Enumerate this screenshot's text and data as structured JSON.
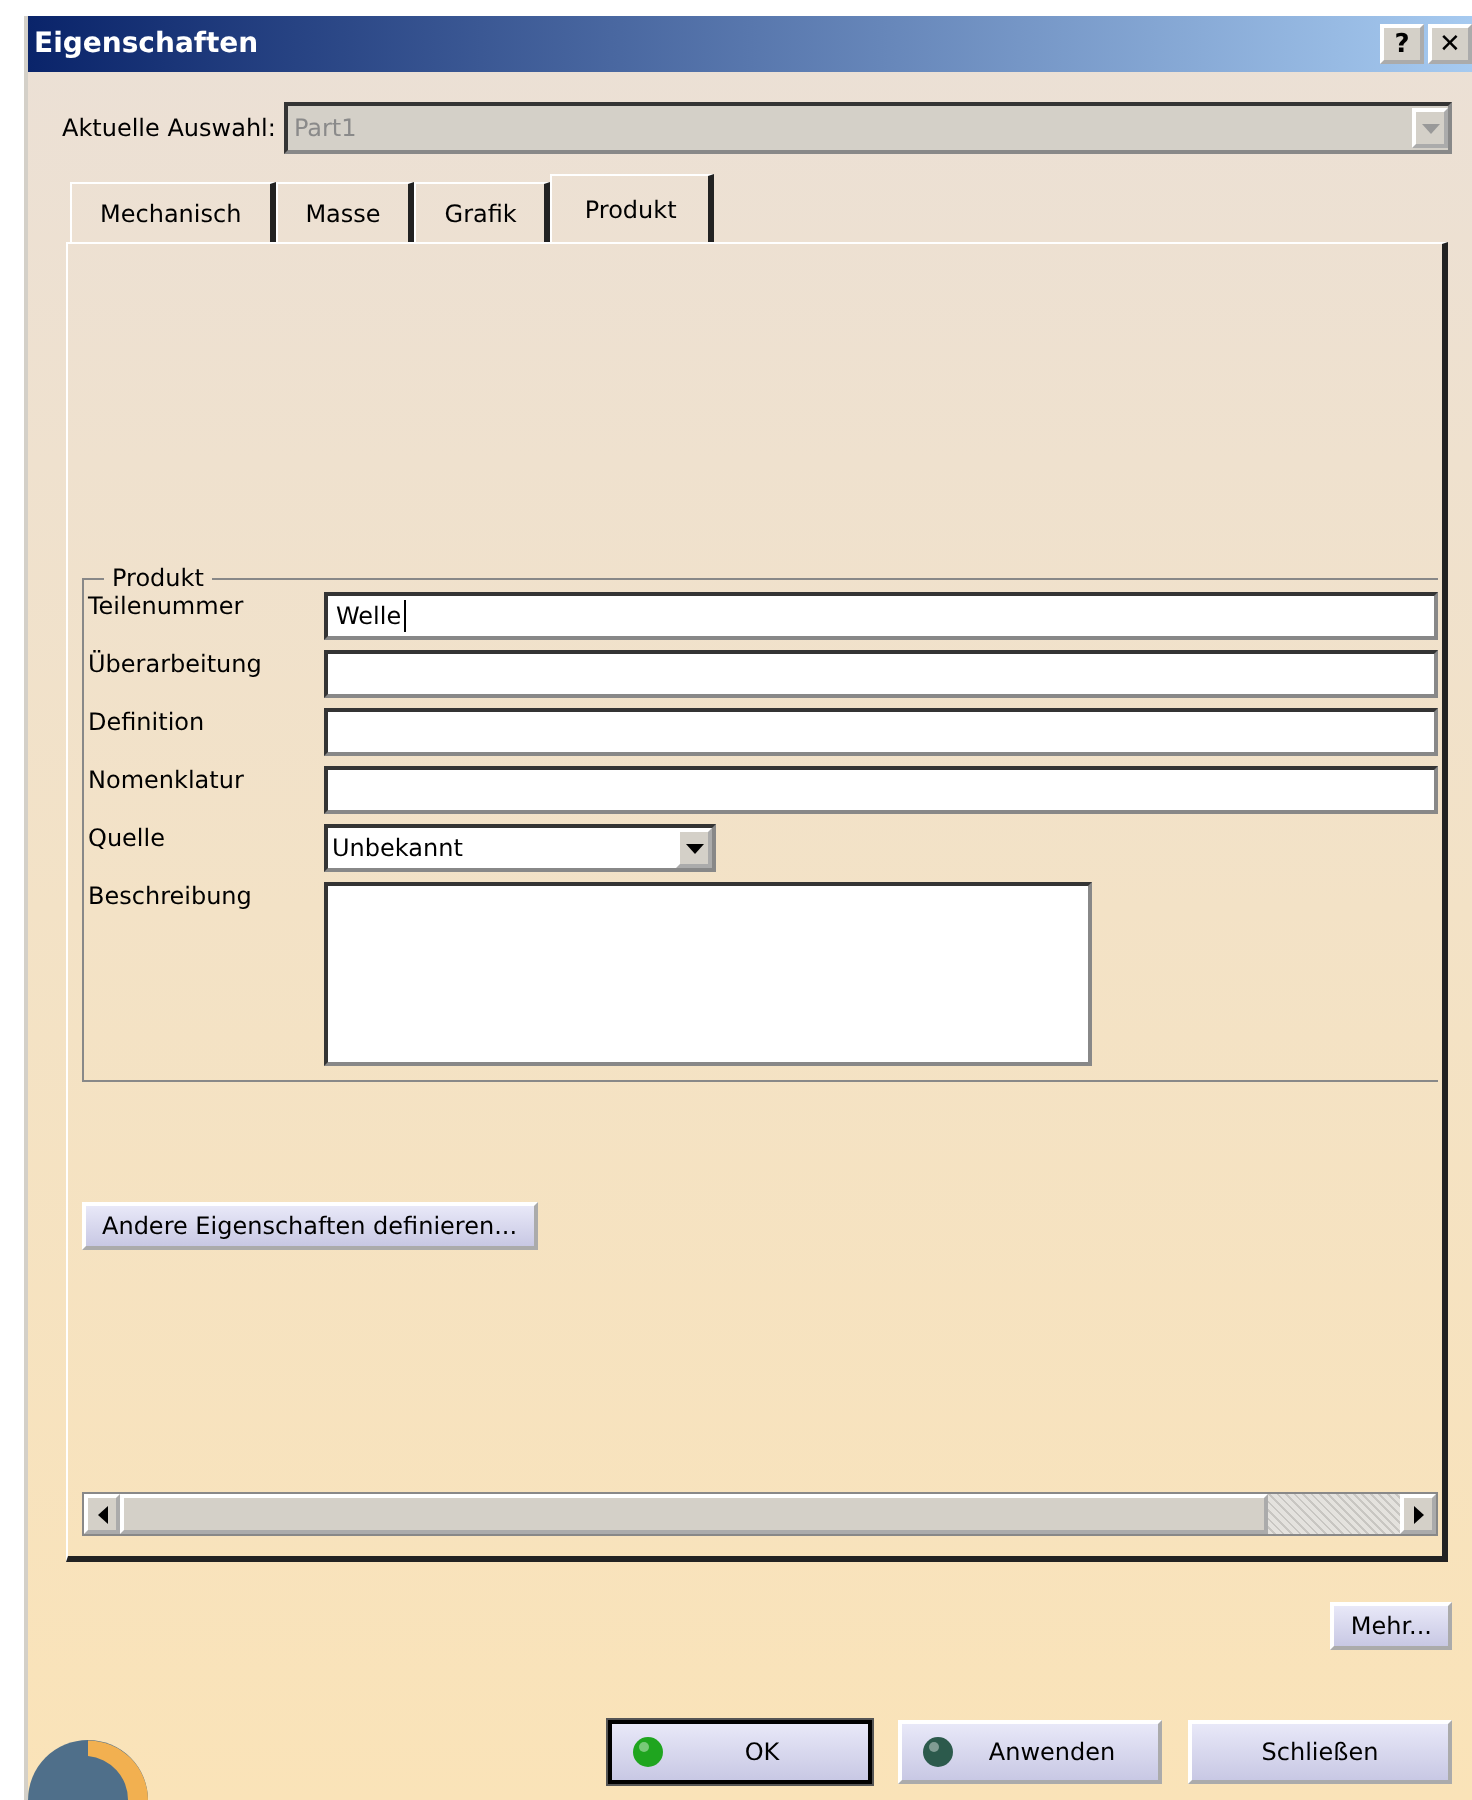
{
  "window": {
    "title": "Eigenschaften",
    "help": "?",
    "close": "✕"
  },
  "selection": {
    "label": "Aktuelle Auswahl:",
    "value": "Part1",
    "disabled": true
  },
  "tabs": [
    {
      "label": "Mechanisch",
      "selected": false
    },
    {
      "label": "Masse",
      "selected": false
    },
    {
      "label": "Grafik",
      "selected": false
    },
    {
      "label": "Produkt",
      "selected": true
    }
  ],
  "group": {
    "title": "Produkt",
    "fields": [
      {
        "kind": "text",
        "label": "Teilenummer",
        "value": "Welle",
        "focused": true
      },
      {
        "kind": "text",
        "label": "Überarbeitung",
        "focused": false
      },
      {
        "kind": "text",
        "label": "Definition",
        "focused": false
      },
      {
        "kind": "text",
        "label": "Nomenklatur",
        "focused": false
      },
      {
        "kind": "select",
        "label": "Quelle",
        "value": "Unbekannt"
      },
      {
        "kind": "textarea",
        "label": "Beschreibung"
      }
    ]
  },
  "define_button": "Andere Eigenschaften definieren...",
  "more_button": "Mehr...",
  "buttons": [
    {
      "label": "OK",
      "kind": "ball",
      "color": "#1fa51f",
      "default": true
    },
    {
      "label": "Anwenden",
      "kind": "ball",
      "color": "#2c5a4c",
      "default": false
    },
    {
      "label": "Schließen",
      "kind": "plain",
      "default": false
    }
  ]
}
